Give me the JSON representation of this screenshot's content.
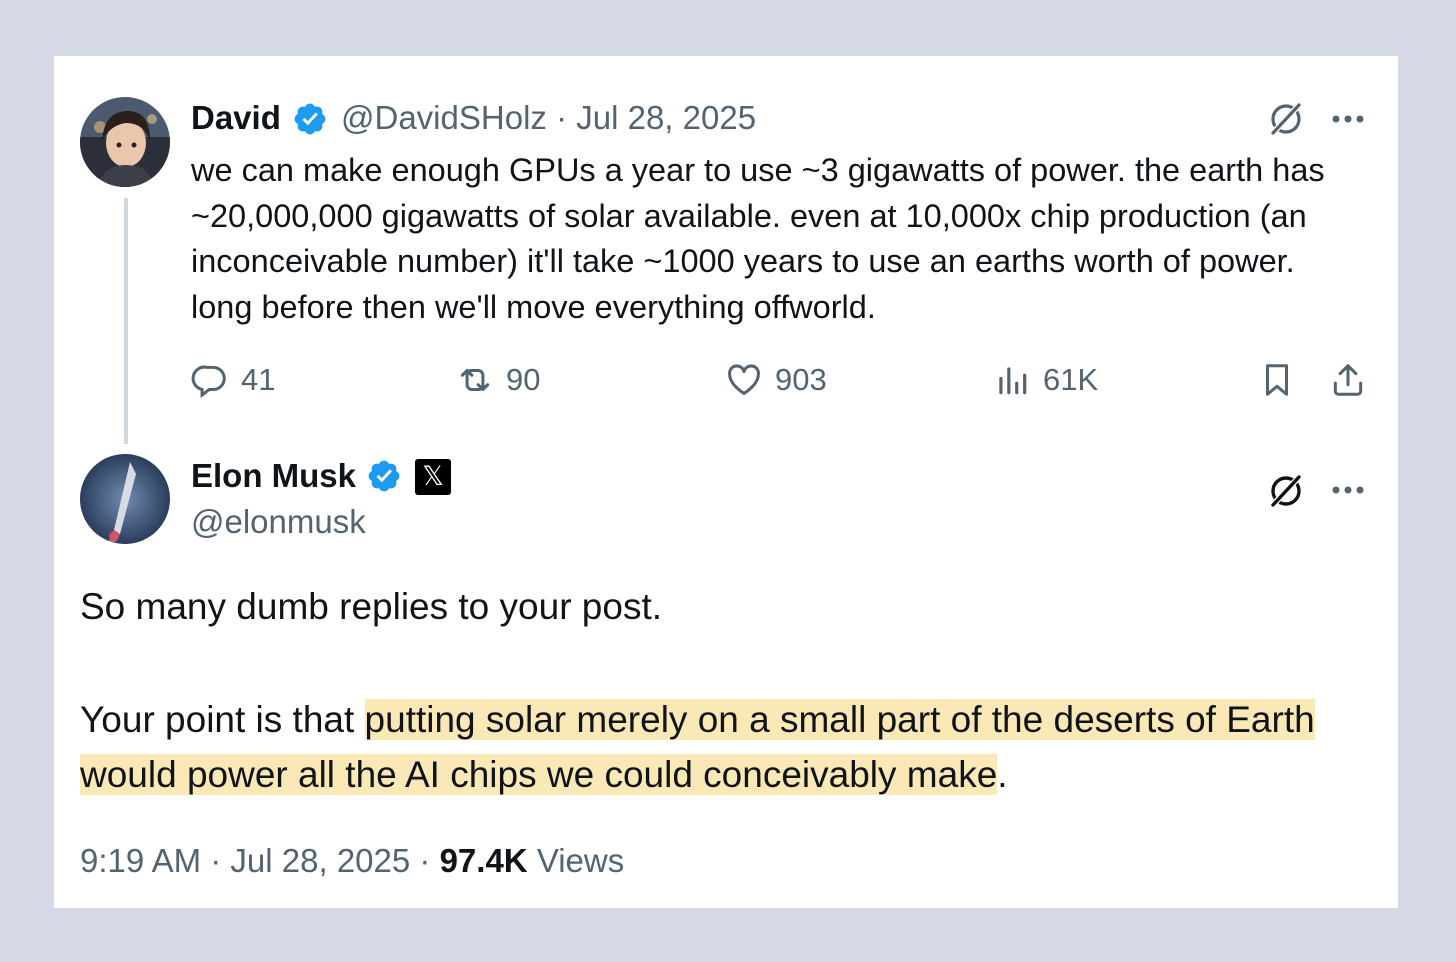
{
  "parent_post": {
    "display_name": "David",
    "handle": "@DavidSHolz",
    "date": "Jul 28, 2025",
    "separator": "·",
    "text": "we can make enough GPUs a year to use ~3 gigawatts of power. the earth has ~20,000,000 gigawatts of solar available. even at 10,000x chip production (an inconceivable number) it'll take ~1000 years to use an earths worth of power. long before then we'll move everything offworld.",
    "replies": "41",
    "reposts": "90",
    "likes": "903",
    "views": "61K",
    "icons": [
      "verified-badge-icon",
      "grok-icon",
      "more-icon",
      "reply-icon",
      "repost-icon",
      "like-icon",
      "views-icon",
      "bookmark-icon",
      "share-icon"
    ]
  },
  "reply_post": {
    "display_name": "Elon Musk",
    "handle": "@elonmusk",
    "affiliate_badge": "𝕏",
    "paragraph_1": "So many dumb replies to your post.",
    "paragraph_2_lead": "Your point is that ",
    "paragraph_2_highlight": "putting solar merely on a small part of the deserts of Earth would power all the AI chips we could conceivably make",
    "paragraph_2_tail": ".",
    "time": "9:19 AM",
    "date": "Jul 28, 2025",
    "separator": "·",
    "views_count": "97.4K",
    "views_label": "Views"
  },
  "colors": {
    "page_background": "#d5d9e5",
    "card_background": "#ffffff",
    "primary_text": "#0f1419",
    "secondary_text": "#536471",
    "verified_blue": "#1d9bf0",
    "highlight": "#fbe8b7"
  }
}
